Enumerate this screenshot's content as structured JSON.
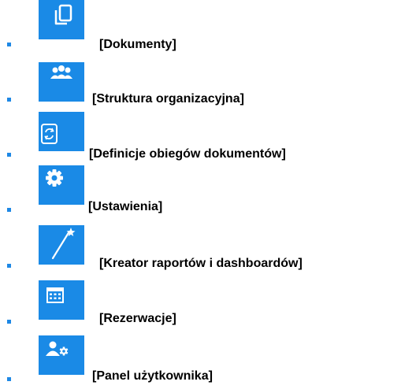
{
  "menu": {
    "accent_color": "#1a8ae6",
    "bullet_color": "#1e88e5",
    "items": [
      {
        "icon": "documents-icon",
        "label": "[Dokumenty]"
      },
      {
        "icon": "users-group-icon",
        "label": "[Struktura organizacyjna]"
      },
      {
        "icon": "document-workflow-icon",
        "label": "[Definicje obiegów dokumentów]"
      },
      {
        "icon": "gear-icon",
        "label": "[Ustawienia]"
      },
      {
        "icon": "magic-wand-icon",
        "label": "[Kreator raportów i dashboardów]"
      },
      {
        "icon": "calendar-icon",
        "label": "[Rezerwacje]"
      },
      {
        "icon": "user-settings-icon",
        "label": "[Panel użytkownika]"
      }
    ]
  }
}
